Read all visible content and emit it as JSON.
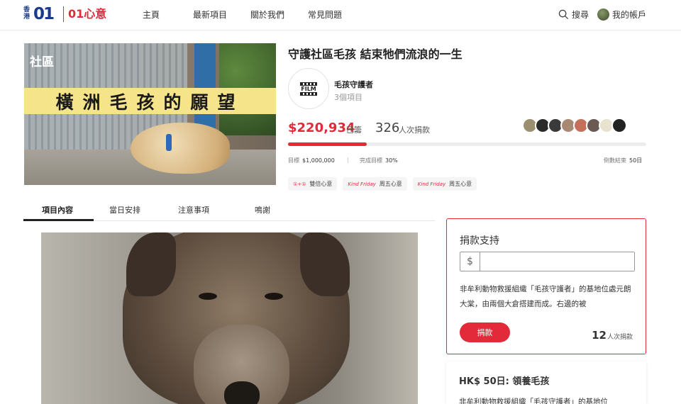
{
  "header": {
    "logo_region": "香港",
    "logo_main": "01",
    "logo_sub": "01心意",
    "nav": [
      {
        "label": "主頁"
      },
      {
        "label": "最新項目"
      },
      {
        "label": "關於我們"
      },
      {
        "label": "常見問題"
      }
    ],
    "search_label": "搜尋",
    "account_label": "我的帳戶"
  },
  "hero": {
    "banner_text": "橫洲毛孩的願望",
    "corner_tag": "社區"
  },
  "project": {
    "title": "守護社區毛孩 結束牠們流浪的一生",
    "org_logo_text": "FILM",
    "org_name": "毛孩守護者",
    "org_project_count": "3個項目",
    "amount_raised": "$220,934",
    "amount_suffix": "已籌",
    "donor_count": "326",
    "donor_suffix": "人次捐款",
    "progress_fraction": 0.22,
    "goal_label": "目標",
    "goal_value": "$1,000,000",
    "completion_label": "完成目標",
    "completion_value": "30%",
    "countdown_label": "倒數結束",
    "countdown_value": "50日",
    "tags": [
      {
        "icon": "①+①",
        "label": "雙倍心意"
      },
      {
        "icon": "Kind Friday",
        "label": "周五心意"
      },
      {
        "icon": "Kind Friday",
        "label": "周五心意"
      }
    ]
  },
  "tabs": [
    {
      "label": "項目內容",
      "active": true
    },
    {
      "label": "當日安排"
    },
    {
      "label": "注意事項"
    },
    {
      "label": "鳴謝"
    }
  ],
  "donate": {
    "title": "捐款支持",
    "currency": "$",
    "amount_value": "",
    "description": "非牟利動物救援組織「毛孩守護者」的基地位處元朗大棠，由兩個大倉搭建而成。右邊的被",
    "button_label": "捐款",
    "count_number": "12",
    "count_suffix": "人次捐款"
  },
  "reward": {
    "title": "HK$ 50日: 領養毛孩",
    "description": "非牟利動物救援組織「毛孩守護者」的基地位"
  },
  "colors": {
    "accent": "#e32a3a",
    "brand_blue": "#1b3a8c"
  }
}
